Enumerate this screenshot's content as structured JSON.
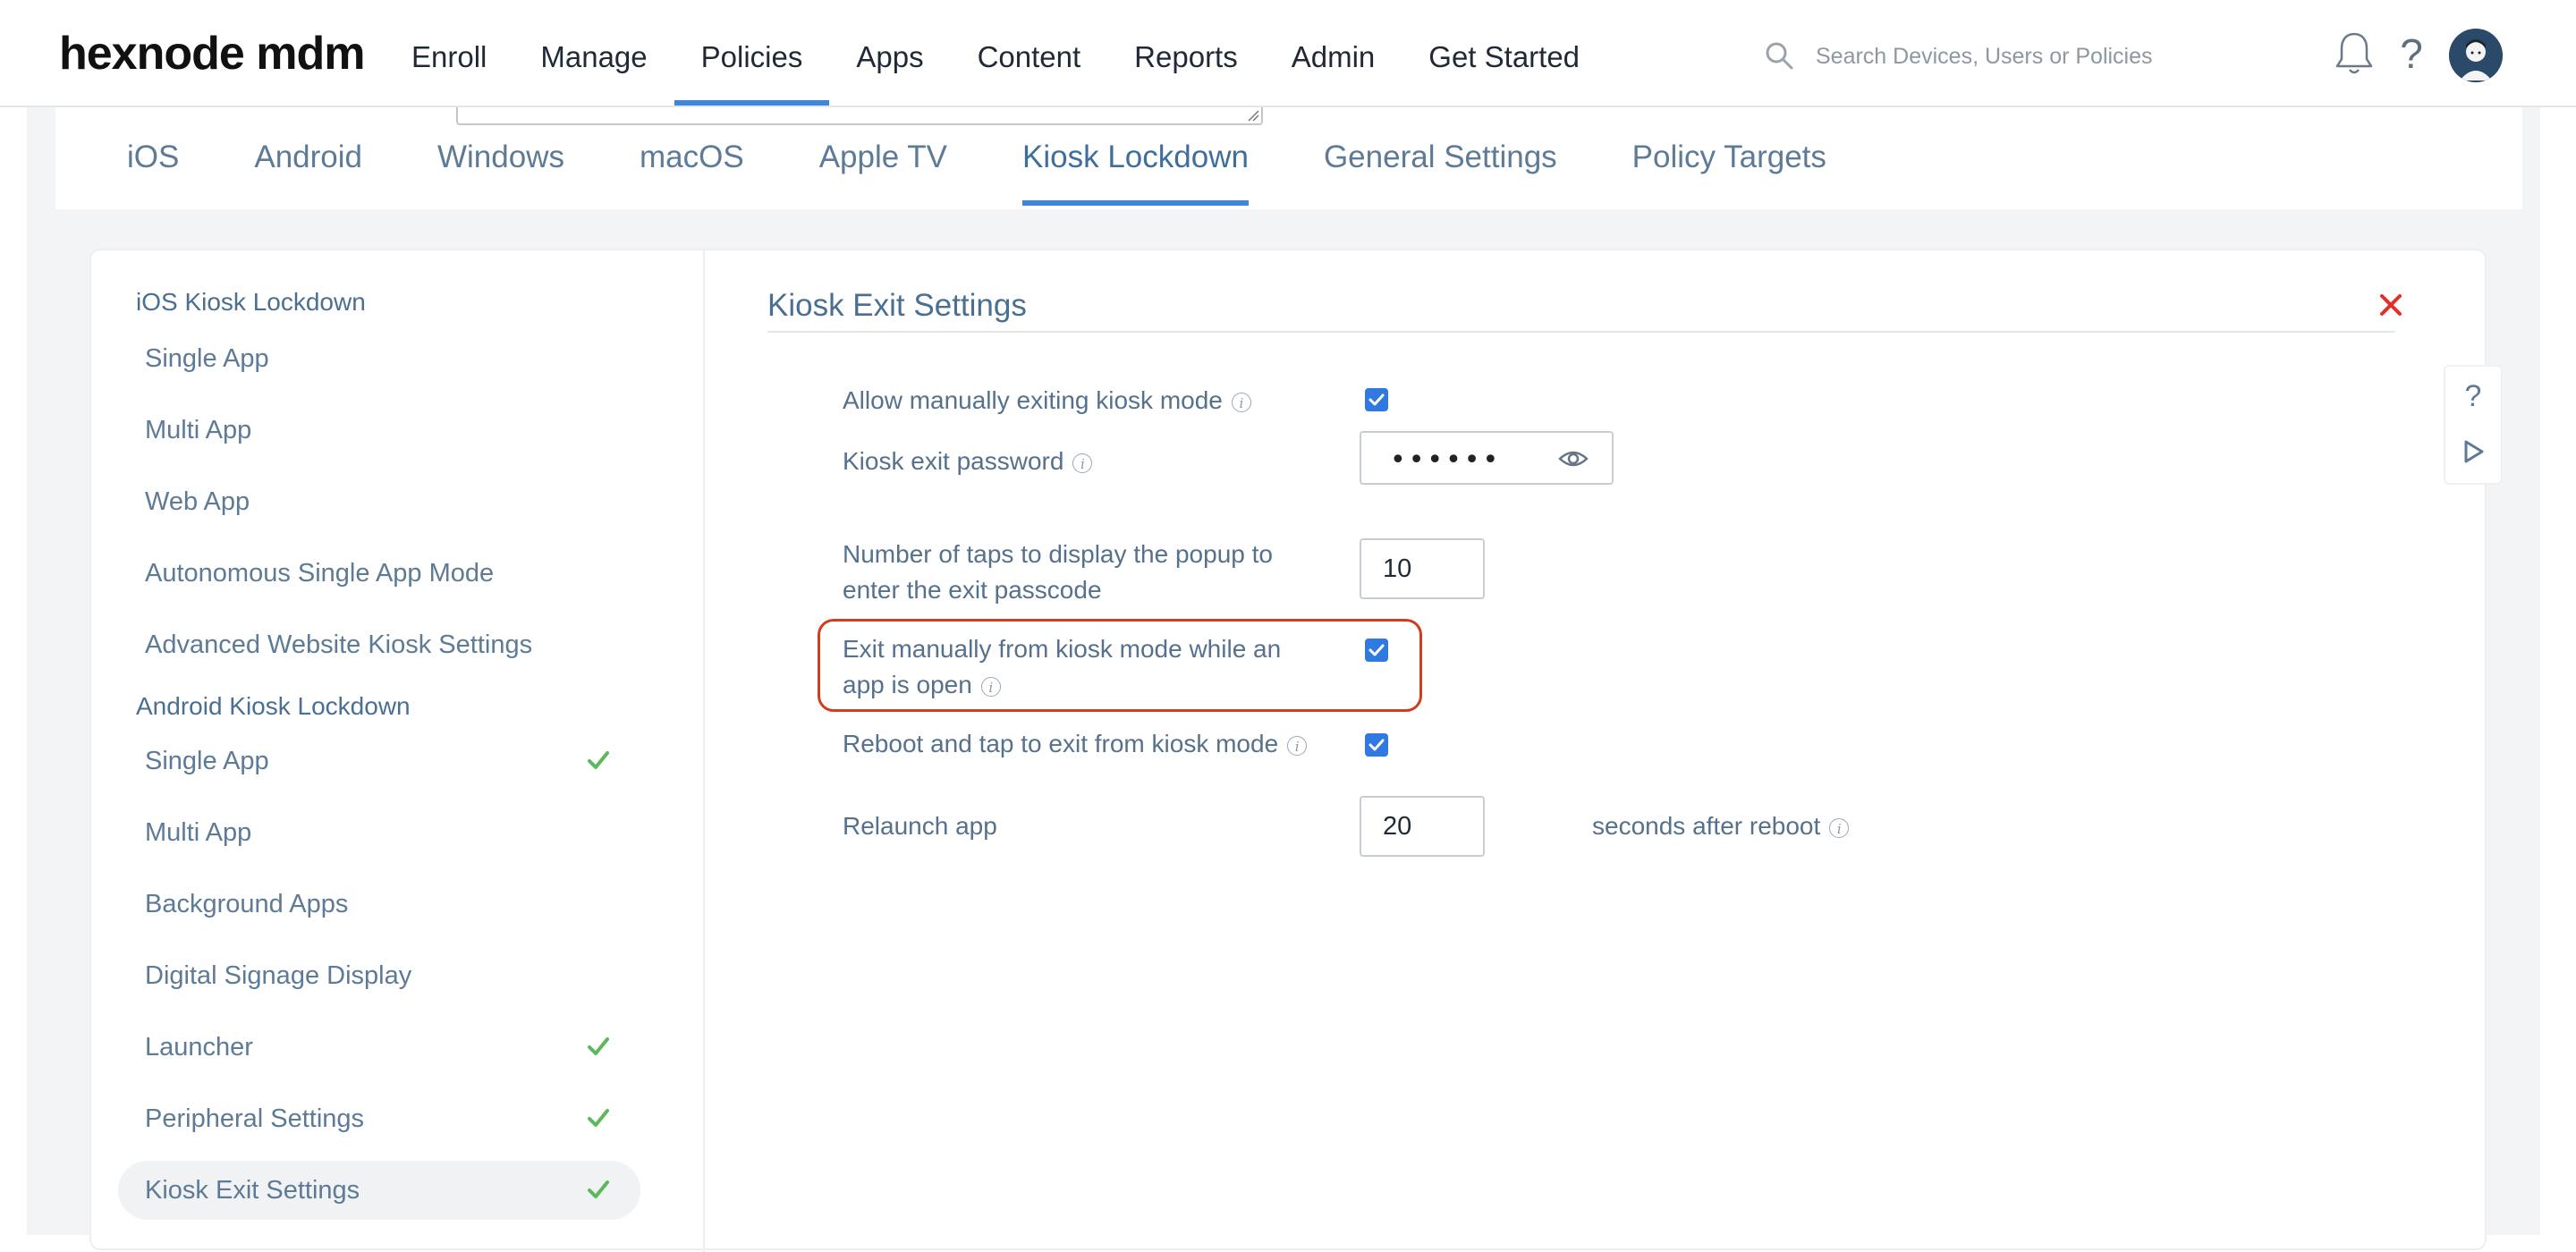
{
  "header": {
    "logo": "hexnode mdm",
    "nav": [
      "Enroll",
      "Manage",
      "Policies",
      "Apps",
      "Content",
      "Reports",
      "Admin",
      "Get Started"
    ],
    "active_nav": "Policies",
    "search_placeholder": "Search Devices, Users or Policies",
    "help_glyph": "?"
  },
  "platform_tabs": [
    "iOS",
    "Android",
    "Windows",
    "macOS",
    "Apple TV",
    "Kiosk Lockdown",
    "General Settings",
    "Policy Targets"
  ],
  "active_platform_tab": "Kiosk Lockdown",
  "sidebar": {
    "ios_section": "iOS Kiosk Lockdown",
    "ios_items": [
      "Single App",
      "Multi App",
      "Web App",
      "Autonomous Single App Mode",
      "Advanced Website Kiosk Settings"
    ],
    "android_section": "Android Kiosk Lockdown",
    "android_items": [
      {
        "label": "Single App",
        "configured": true
      },
      {
        "label": "Multi App",
        "configured": false
      },
      {
        "label": "Background Apps",
        "configured": false
      },
      {
        "label": "Digital Signage Display",
        "configured": false
      },
      {
        "label": "Launcher",
        "configured": true
      },
      {
        "label": "Peripheral Settings",
        "configured": true
      },
      {
        "label": "Kiosk Exit Settings",
        "configured": true,
        "active": true
      }
    ]
  },
  "content": {
    "title": "Kiosk Exit Settings",
    "allow_manual_exit": {
      "label": "Allow manually exiting kiosk mode",
      "checked": true
    },
    "exit_password": {
      "label": "Kiosk exit password",
      "value": "••••••"
    },
    "taps": {
      "label_line1": "Number of taps to display the popup to",
      "label_line2": "enter the exit passcode",
      "value": "10"
    },
    "exit_while_app_open": {
      "label_line1": "Exit manually from kiosk mode while an",
      "label_line2": "app is open",
      "checked": true
    },
    "reboot_tap_exit": {
      "label": "Reboot and tap to exit from kiosk mode",
      "checked": true
    },
    "relaunch": {
      "label": "Relaunch app",
      "value": "20",
      "suffix": "seconds after reboot"
    }
  },
  "help_panel": {
    "question": "?"
  },
  "colors": {
    "accent": "#3f86d8",
    "checkbox": "#2f79e0",
    "highlight": "#d43a1e",
    "check_green": "#5cb85c",
    "close_red": "#e0312b"
  }
}
